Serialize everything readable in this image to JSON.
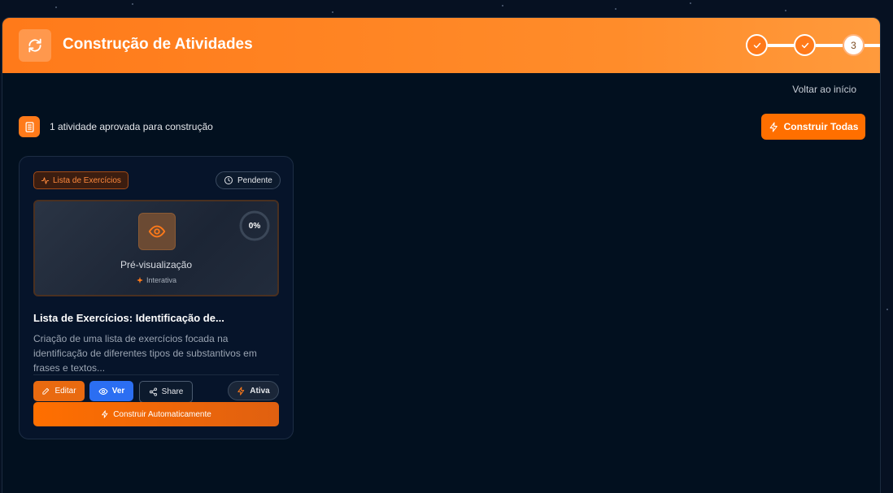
{
  "header": {
    "title": "Construção de Atividades",
    "steps": [
      {
        "state": "done",
        "label": ""
      },
      {
        "state": "done",
        "label": ""
      },
      {
        "state": "current",
        "label": "3"
      }
    ]
  },
  "nav": {
    "back_label": "Voltar ao início"
  },
  "summary": {
    "count_text": "1 atividade aprovada para construção",
    "build_all_label": "Construir Todas"
  },
  "activity": {
    "type_tag": "Lista de Exercícios",
    "status": "Pendente",
    "preview_label": "Pré-visualização",
    "preview_sub": "Interativa",
    "progress_text": "0%",
    "progress_value": 0,
    "title": "Lista de Exercícios: Identificação de...",
    "description": "Criação de uma lista de exercícios focada na identificação de diferentes tipos de substantivos em frases e textos...",
    "actions": {
      "edit": "Editar",
      "view": "Ver",
      "share": "Share",
      "active": "Ativa",
      "auto_build": "Construir Automaticamente"
    }
  },
  "colors": {
    "accent": "#ff7a1a",
    "view_button": "#2b6ef2",
    "background": "#02101f"
  }
}
